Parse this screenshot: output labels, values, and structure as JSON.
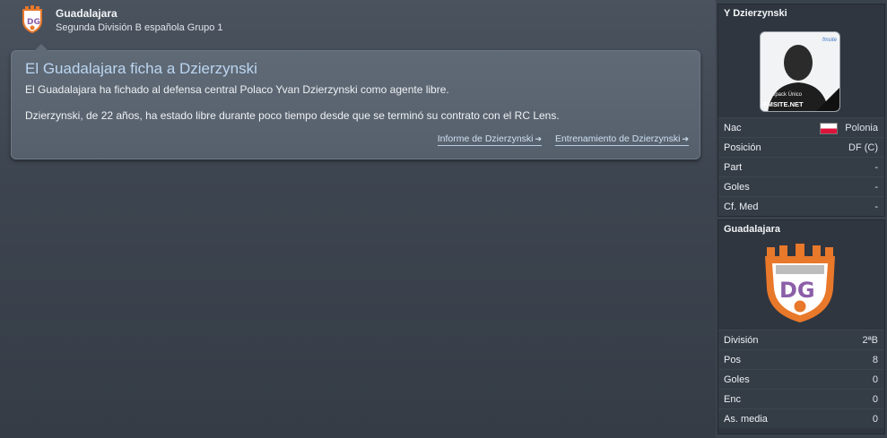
{
  "header": {
    "club_name": "Guadalajara",
    "league": "Segunda División B española Grupo 1",
    "crest_icon": "club-crest-icon"
  },
  "news": {
    "title": "El Guadalajara ficha a Dzierzynski",
    "paragraph1": "El Guadalajara ha fichado al defensa central Polaco Yvan Dzierzynski como agente libre.",
    "paragraph2": "Dzierzynski, de 22 años, ha estado libre durante poco tiempo desde que se terminó su contrato con el RC Lens.",
    "links": [
      {
        "label": "Informe de Dzierzynski",
        "icon": "arrow-right-icon"
      },
      {
        "label": "Entrenamiento de Dzierzynski",
        "icon": "arrow-right-icon"
      }
    ]
  },
  "player_panel": {
    "name": "Y Dzierzynski",
    "photo_credit_small": "Facepack Único",
    "photo_credit_big": "FMSITE.NET",
    "photo_brand": "fmsite",
    "rows": [
      {
        "label": "Nac",
        "value": "Polonia"
      },
      {
        "label": "Posición",
        "value": "DF (C)"
      },
      {
        "label": "Part",
        "value": "-"
      },
      {
        "label": "Goles",
        "value": "-"
      },
      {
        "label": "Cf. Med",
        "value": "-"
      }
    ]
  },
  "club_panel": {
    "name": "Guadalajara",
    "rows": [
      {
        "label": "División",
        "value": "2ªB"
      },
      {
        "label": "Pos",
        "value": "8"
      },
      {
        "label": "Goles",
        "value": "0"
      },
      {
        "label": "Enc",
        "value": "0"
      },
      {
        "label": "As. media",
        "value": "0"
      }
    ]
  },
  "colors": {
    "crest_orange": "#e8782a",
    "crest_purple": "#8b5fa8",
    "link": "#cfe0f2",
    "title": "#bcd6f2"
  }
}
